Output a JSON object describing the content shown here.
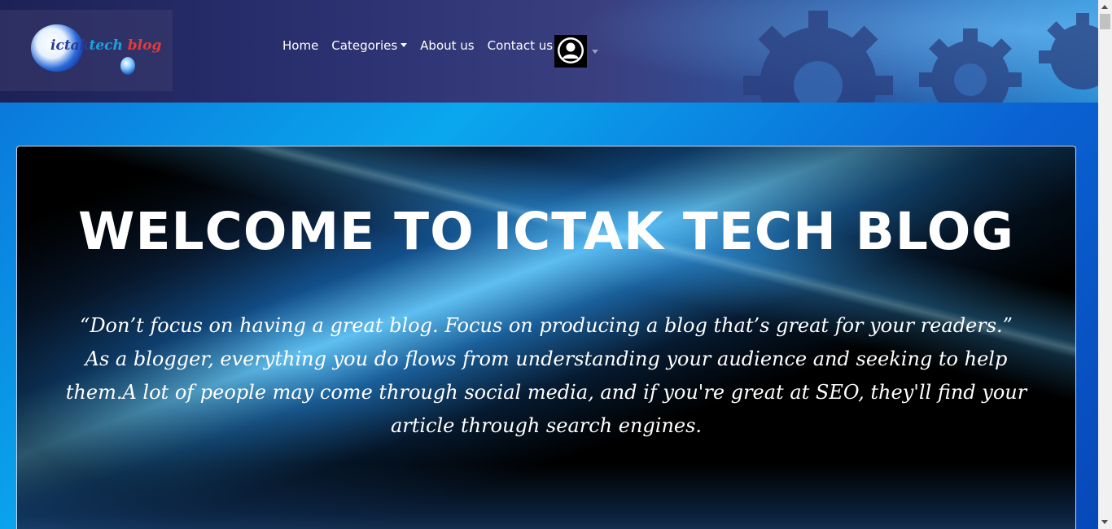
{
  "navbar": {
    "logo": {
      "part1": "i",
      "part2": "ctak",
      "part3": "tech",
      "part4": " blog"
    },
    "links": [
      {
        "label": "Home"
      },
      {
        "label": "Categories",
        "has_dropdown": true
      },
      {
        "label": "About us"
      },
      {
        "label": "Contact us"
      }
    ],
    "account_icon": "user-avatar-icon"
  },
  "hero": {
    "title": "WELCOME TO ICTAK TECH BLOG",
    "quote": "“Don’t focus on having a great blog. Focus on producing a blog that’s great for your readers.”",
    "body": "As a blogger, everything you do flows from understanding your audience and seeking to help them.A lot of people may come through social media, and if you're great at SEO, they'll find your article through search engines."
  },
  "colors": {
    "navbar_bg": "#2b3170",
    "page_bg": "#0a8fe6",
    "hero_bg": "#000000",
    "text": "#ffffff"
  }
}
